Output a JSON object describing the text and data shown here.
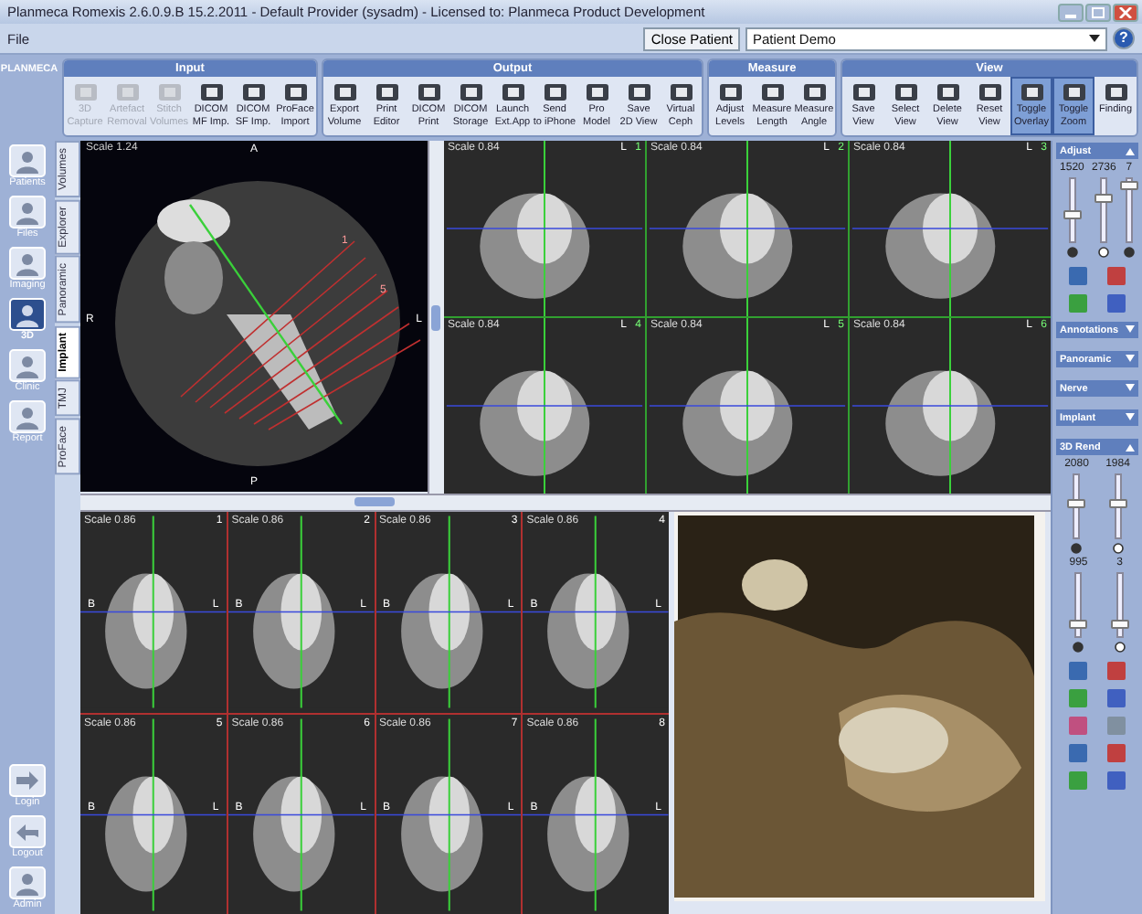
{
  "window": {
    "title": "Planmeca Romexis 2.6.0.9.B  15.2.2011 - Default Provider (sysadm) - Licensed to: Planmeca Product Development"
  },
  "menu": [
    "File"
  ],
  "patient_bar": {
    "button": "Close Patient",
    "patient": "Patient Demo",
    "help": "?"
  },
  "toolbar_groups": [
    {
      "title": "Input",
      "buttons": [
        {
          "label": "3D\nCapture",
          "disabled": true,
          "selected": false
        },
        {
          "label": "Artefact\nRemoval",
          "disabled": true,
          "selected": false
        },
        {
          "label": "Stitch\nVolumes",
          "disabled": true,
          "selected": false
        },
        {
          "label": "DICOM\nMF Imp.",
          "disabled": false,
          "selected": false
        },
        {
          "label": "DICOM\nSF Imp.",
          "disabled": false,
          "selected": false
        },
        {
          "label": "ProFace\nImport",
          "disabled": false,
          "selected": false
        }
      ]
    },
    {
      "title": "Output",
      "buttons": [
        {
          "label": "Export\nVolume",
          "disabled": false,
          "selected": false
        },
        {
          "label": "Print\nEditor",
          "disabled": false,
          "selected": false
        },
        {
          "label": "DICOM\nPrint",
          "disabled": false,
          "selected": false
        },
        {
          "label": "DICOM\nStorage",
          "disabled": false,
          "selected": false
        },
        {
          "label": "Launch\nExt.App",
          "disabled": false,
          "selected": false
        },
        {
          "label": "Send\nto iPhone",
          "disabled": false,
          "selected": false
        },
        {
          "label": "Pro\nModel",
          "disabled": false,
          "selected": false
        },
        {
          "label": "Save\n2D View",
          "disabled": false,
          "selected": false
        },
        {
          "label": "Virtual\nCeph",
          "disabled": false,
          "selected": false
        }
      ]
    },
    {
      "title": "Measure",
      "buttons": [
        {
          "label": "Adjust\nLevels",
          "disabled": false,
          "selected": false
        },
        {
          "label": "Measure\nLength",
          "disabled": false,
          "selected": false
        },
        {
          "label": "Measure\nAngle",
          "disabled": false,
          "selected": false
        }
      ]
    },
    {
      "title": "View",
      "buttons": [
        {
          "label": "Save\nView",
          "disabled": false,
          "selected": false
        },
        {
          "label": "Select\nView",
          "disabled": false,
          "selected": false
        },
        {
          "label": "Delete\nView",
          "disabled": false,
          "selected": false
        },
        {
          "label": "Reset\nView",
          "disabled": false,
          "selected": false
        },
        {
          "label": "Toggle\nOverlay",
          "disabled": false,
          "selected": true
        },
        {
          "label": "Toggle\nZoom",
          "disabled": false,
          "selected": true
        },
        {
          "label": "Finding",
          "disabled": false,
          "selected": false
        }
      ]
    }
  ],
  "nav": {
    "logo": "PLANMECA",
    "items": [
      {
        "label": "Patients",
        "selected": false
      },
      {
        "label": "Files",
        "selected": false
      },
      {
        "label": "Imaging",
        "selected": false
      },
      {
        "label": "3D",
        "selected": true
      },
      {
        "label": "Clinic",
        "selected": false
      },
      {
        "label": "Report",
        "selected": false
      }
    ],
    "bottom_items": [
      {
        "label": "Login",
        "kind": "login"
      },
      {
        "label": "Logout",
        "kind": "logout"
      },
      {
        "label": "Admin",
        "kind": "person"
      }
    ]
  },
  "view_tabs": [
    {
      "label": "Volumes",
      "selected": false
    },
    {
      "label": "Explorer",
      "selected": false
    },
    {
      "label": "Panoramic",
      "selected": false
    },
    {
      "label": "Implant",
      "selected": true
    },
    {
      "label": "TMJ",
      "selected": false
    },
    {
      "label": "ProFace",
      "selected": false
    }
  ],
  "axial_view": {
    "scale": "Scale 1.24",
    "top": "A",
    "left": "R",
    "right": "L",
    "bottom": "P",
    "marks": [
      "1",
      "5"
    ]
  },
  "cross_sections": [
    {
      "scale": "Scale 0.84",
      "side": "L",
      "number": "1"
    },
    {
      "scale": "Scale 0.84",
      "side": "L",
      "number": "2"
    },
    {
      "scale": "Scale 0.84",
      "side": "L",
      "number": "3"
    },
    {
      "scale": "Scale 0.84",
      "side": "L",
      "number": "4"
    },
    {
      "scale": "Scale 0.84",
      "side": "L",
      "number": "5"
    },
    {
      "scale": "Scale 0.84",
      "side": "L",
      "number": "6"
    }
  ],
  "implant_sections": [
    {
      "scale": "Scale 0.86",
      "left": "B",
      "right": "L",
      "number": "1"
    },
    {
      "scale": "Scale 0.86",
      "left": "B",
      "right": "L",
      "number": "2"
    },
    {
      "scale": "Scale 0.86",
      "left": "B",
      "right": "L",
      "number": "3"
    },
    {
      "scale": "Scale 0.86",
      "left": "B",
      "right": "L",
      "number": "4"
    },
    {
      "scale": "Scale 0.86",
      "left": "B",
      "right": "L",
      "number": "5"
    },
    {
      "scale": "Scale 0.86",
      "left": "B",
      "right": "L",
      "number": "6"
    },
    {
      "scale": "Scale 0.86",
      "left": "B",
      "right": "L",
      "number": "7"
    },
    {
      "scale": "Scale 0.86",
      "left": "B",
      "right": "L",
      "number": "8"
    }
  ],
  "side_panel": {
    "sections": [
      {
        "title": "Adjust",
        "expanded": true,
        "sliders": [
          {
            "reading": "1520",
            "level": 0.45
          },
          {
            "reading": "2736",
            "level": 0.72
          },
          {
            "reading": "7",
            "level": 0.9
          }
        ]
      },
      {
        "title": "Annotations",
        "expanded": false
      },
      {
        "title": "Panoramic",
        "expanded": false
      },
      {
        "title": "Nerve",
        "expanded": false
      },
      {
        "title": "Implant",
        "expanded": false
      },
      {
        "title": "3D Rend",
        "expanded": true,
        "sliders": [
          {
            "reading": "2080",
            "level": 0.55
          },
          {
            "reading": "1984",
            "level": 0.55
          },
          {
            "reading": "995",
            "level": 0.2
          },
          {
            "reading": "3",
            "level": 0.2
          }
        ]
      }
    ]
  }
}
